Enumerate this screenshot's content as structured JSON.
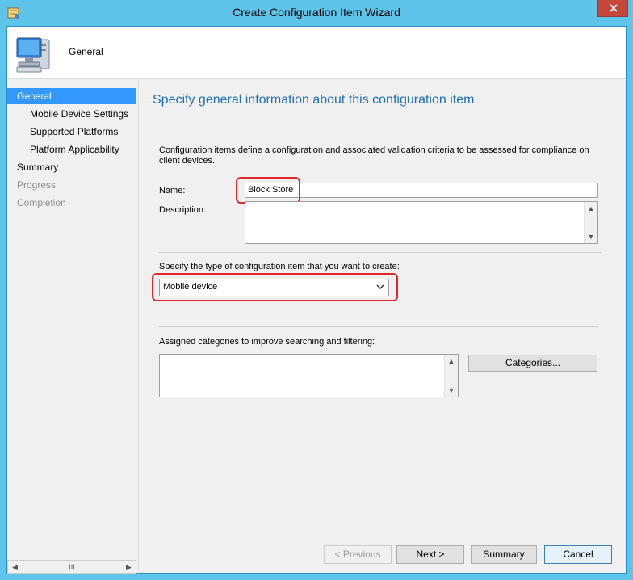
{
  "window": {
    "title": "Create Configuration Item Wizard"
  },
  "header": {
    "title": "General"
  },
  "nav": {
    "items": [
      {
        "label": "General",
        "state": "active"
      },
      {
        "label": "Mobile Device Settings",
        "state": "sub"
      },
      {
        "label": "Supported Platforms",
        "state": "sub"
      },
      {
        "label": "Platform Applicability",
        "state": "sub"
      },
      {
        "label": "Summary",
        "state": "normal"
      },
      {
        "label": "Progress",
        "state": "disabled"
      },
      {
        "label": "Completion",
        "state": "disabled"
      }
    ],
    "scroll_thumb": "III"
  },
  "main": {
    "heading": "Specify general information about this configuration item",
    "intro": "Configuration items define a configuration and associated validation criteria to be assessed for compliance on client devices.",
    "name_label": "Name:",
    "name_value": "Block Store",
    "description_label": "Description:",
    "description_value": "",
    "type_label": "Specify the type of configuration item that you want to create:",
    "type_value": "Mobile device",
    "categories_label": "Assigned categories to improve searching and filtering:",
    "categories_value": "",
    "categories_button": "Categories..."
  },
  "footer": {
    "previous": "< Previous",
    "next": "Next >",
    "summary": "Summary",
    "cancel": "Cancel"
  },
  "colors": {
    "accent": "#3399ff",
    "heading": "#1e6fb8",
    "highlight": "#e0252b",
    "titlebar": "#5ec4ea"
  }
}
